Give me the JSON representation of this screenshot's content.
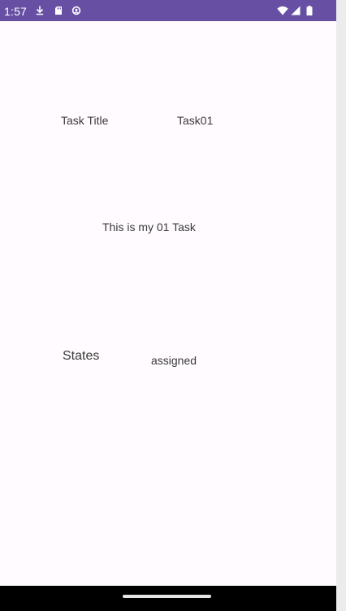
{
  "status_bar": {
    "time": "1:57",
    "icons": [
      "download-icon",
      "sd-card-icon",
      "sync-icon",
      "wifi-icon",
      "signal-icon",
      "battery-icon"
    ],
    "background_color": "#6750a4"
  },
  "task": {
    "title_label": "Task Title",
    "title_value": "Task01",
    "description": "This is my 01 Task",
    "states_label": "States",
    "states_value": "assigned"
  },
  "colors": {
    "background": "#fffbfe",
    "text": "#3a3a3a",
    "navigation_bar": "#000000"
  }
}
